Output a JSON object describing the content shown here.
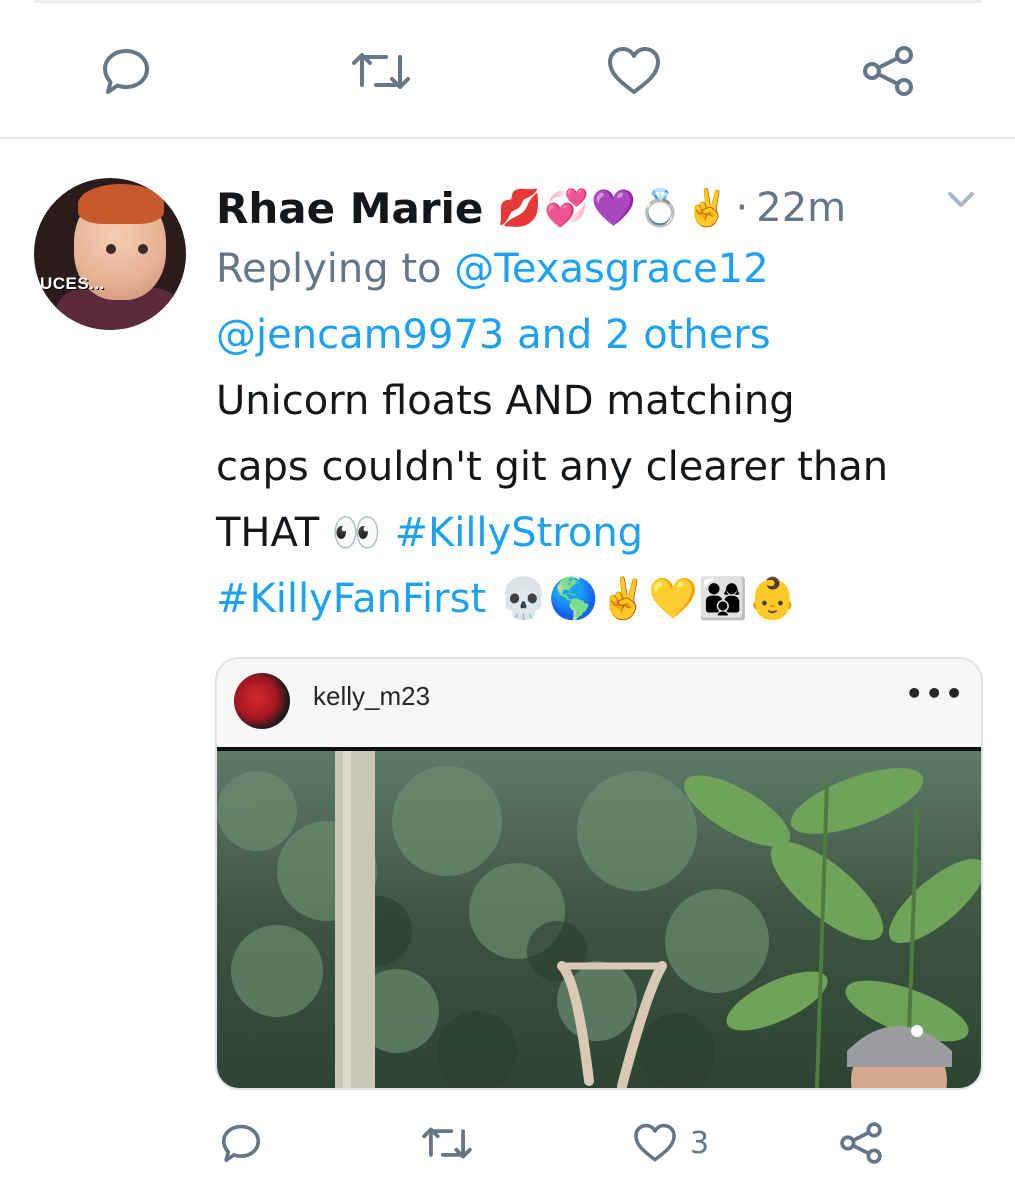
{
  "top_actions": {
    "reply_icon": "reply-icon",
    "retweet_icon": "retweet-icon",
    "like_icon": "heart-icon",
    "share_icon": "share-icon"
  },
  "tweet": {
    "display_name": "Rhae Marie",
    "name_emojis": "💋💞💜💍✌️",
    "separator": "·",
    "timestamp": "22m",
    "avatar_caption": "UCES...",
    "replying_prefix": "Replying to",
    "reply_to_1": "@Texasgrace12",
    "reply_to_2": "@jencam9973",
    "and_others": "and 2 others",
    "text_line1": "Unicorn floats AND matching",
    "text_line2": "caps couldn't git any clearer than",
    "text_line3_plain": "THAT 👀",
    "hashtag_1": "#KillyStrong",
    "hashtag_2": "#KillyFanFirst",
    "trailing_emojis": "💀🌎✌️💛👨‍👩‍👦👶"
  },
  "embed": {
    "username": "kelly_m23",
    "more_label": "•••"
  },
  "bottom_actions": {
    "like_count": "3"
  },
  "colors": {
    "accent": "#1da1f2",
    "secondary_text": "#657786",
    "icon": "#657786",
    "divider": "#e1e8ed"
  }
}
